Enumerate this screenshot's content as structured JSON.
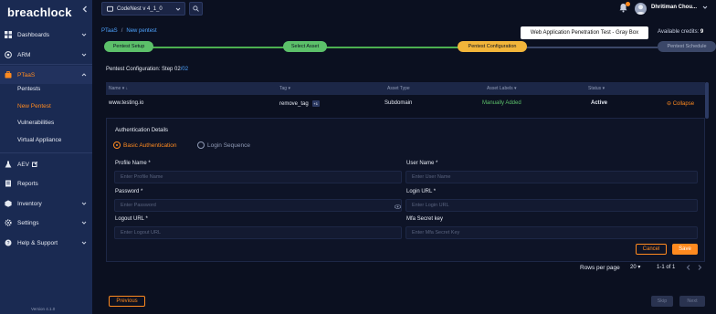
{
  "brand": {
    "logo_text": "breachlock"
  },
  "sidebar": {
    "items": [
      {
        "label": "Dashboards",
        "icon": "grid-icon"
      },
      {
        "label": "ARM",
        "icon": "target-icon"
      },
      {
        "label": "PTaaS",
        "icon": "briefcase-icon"
      },
      {
        "label": "AEV",
        "icon": "flask-icon"
      },
      {
        "label": "Reports",
        "icon": "document-icon"
      },
      {
        "label": "Inventory",
        "icon": "box-icon"
      },
      {
        "label": "Settings",
        "icon": "gear-icon"
      },
      {
        "label": "Help & Support",
        "icon": "help-icon"
      }
    ],
    "ptaas_subitems": [
      "Pentests",
      "New Pentest",
      "Vulnerabilities",
      "Virtual Appliance"
    ],
    "active_subitem": "New Pentest",
    "version": "Version 4.1.0"
  },
  "topbar": {
    "project": "CodeNest v 4_1_0",
    "user_name": "Dhritiman Chou..."
  },
  "breadcrumb": [
    "PTaaS",
    "New pentest"
  ],
  "test_type_badge": "Web Application Penetration Test - Gray Box",
  "credits": {
    "label": "Available credits:",
    "value": "9"
  },
  "stepper": [
    "Pentest Setup",
    "Select Asset",
    "Pentest Configuration",
    "Pentest Schedule"
  ],
  "config": {
    "title": "Pentest Configuration: Step 02",
    "max": "/02"
  },
  "table": {
    "headers": [
      "Name",
      "Tag",
      "Asset Type",
      "Asset Labels",
      "Status"
    ],
    "row": {
      "name": "www.testing.io",
      "tag": "remove_tag",
      "tag_count": "+1",
      "asset_type": "Subdomain",
      "asset_labels": "Manually Added",
      "status": "Active",
      "action": "Collapse"
    }
  },
  "auth": {
    "title": "Authentication Details",
    "options": [
      "Basic Authentication",
      "Login Sequence"
    ],
    "fields": [
      {
        "label": "Profile Name *",
        "placeholder": "Enter Profile Name"
      },
      {
        "label": "User Name *",
        "placeholder": "Enter User Name"
      },
      {
        "label": "Password *",
        "placeholder": "Enter Password"
      },
      {
        "label": "Login URL *",
        "placeholder": "Enter Login URL"
      },
      {
        "label": "Logout URL *",
        "placeholder": "Enter Logout URL"
      },
      {
        "label": "Mfa Secret key",
        "placeholder": "Enter Mfa Secret Key"
      }
    ],
    "cancel": "Cancel",
    "save": "Save"
  },
  "pagination": {
    "rows_label": "Rows per page",
    "rows_value": "20",
    "range": "1-1 of 1"
  },
  "footer": {
    "previous": "Previous",
    "skip": "Skip",
    "next": "Next"
  },
  "colors": {
    "accent": "#ff8a1f",
    "sidebar": "#1a2a52",
    "success": "#5cc06a",
    "link": "#4ea3ff"
  }
}
